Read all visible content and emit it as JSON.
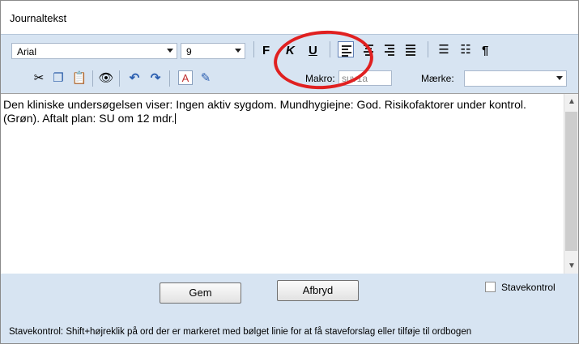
{
  "window": {
    "title": "Journaltekst"
  },
  "toolbar": {
    "font_family": "Arial",
    "font_size": "9",
    "bold": "F",
    "italic": "K",
    "underline": "U",
    "pilcrow": "¶",
    "makro_label": "Makro:",
    "makro_value": "suv1a",
    "maerke_label": "Mærke:",
    "maerke_value": ""
  },
  "editor": {
    "text": "Den kliniske undersøgelsen viser: Ingen aktiv sygdom. Mundhygiejne: God. Risikofaktorer under kontrol. (Grøn). Aftalt plan: SU om 12 mdr."
  },
  "buttons": {
    "save": "Gem",
    "cancel": "Afbryd"
  },
  "spellcheck": {
    "label": "Stavekontrol",
    "checked": false
  },
  "status": "Stavekontrol: Shift+højreklik på ord der er markeret med  bølget linie for at få staveforslag eller tilføje til ordbogen",
  "colors": {
    "toolbar_bg": "#d7e4f2",
    "annotation": "#e02020"
  }
}
